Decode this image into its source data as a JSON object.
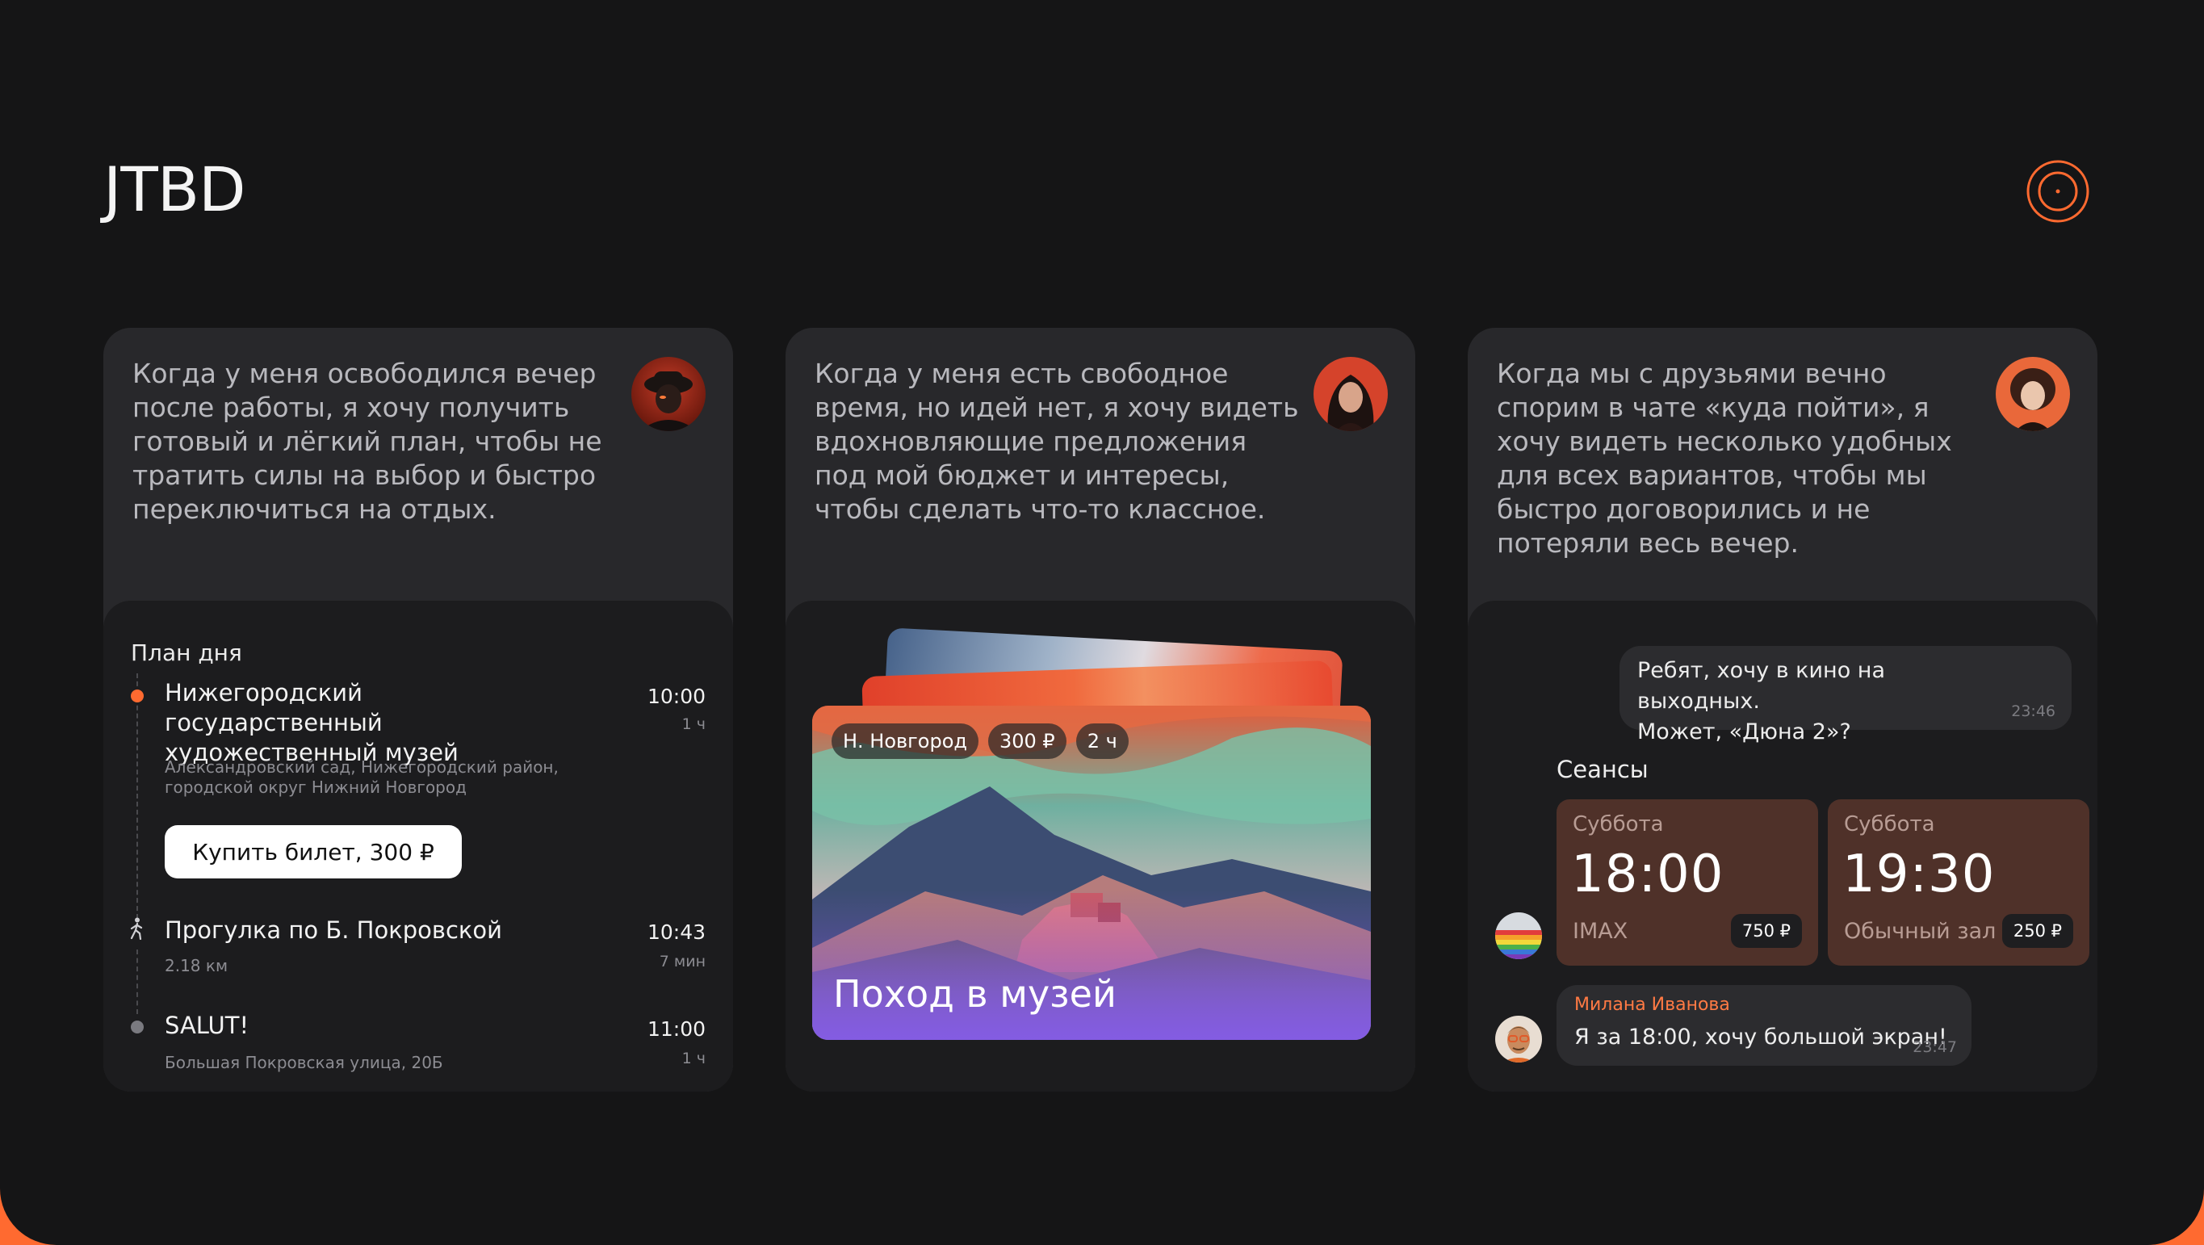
{
  "page": {
    "title": "JTBD",
    "accent_color": "#ff6a30",
    "target_icon": "target-icon"
  },
  "cards": [
    {
      "quote": "Когда у меня освободился вечер после работы, я хочу получить готовый и лёгкий план, чтобы не тратить силы на выбор и быстро переключиться на отдых.",
      "avatar": "person-in-hat-avatar",
      "plan": {
        "title": "План дня",
        "events": [
          {
            "title": "Нижегородский государственный художественный музей",
            "subtitle": "Александровский сад, Нижегородский район, городской округ Нижний Новгород",
            "time": "10:00",
            "duration": "1 ч",
            "button": "Купить билет, 300 ₽"
          },
          {
            "title": "Прогулка по Б. Покровской",
            "subtitle": "2.18 км",
            "time": "10:43",
            "duration": "7 мин"
          },
          {
            "title": "SALUT!",
            "subtitle": "Большая Покровская улица, 20Б",
            "time": "11:00",
            "duration": "1 ч"
          }
        ]
      }
    },
    {
      "quote": "Когда у меня есть свободное время, но идей нет, я хочу видеть вдохновляющие предложения под мой бюджет и интересы, чтобы сделать что-то классное.",
      "avatar": "woman-red-background-avatar",
      "offer": {
        "chips": [
          "Н. Новгород",
          "300 ₽",
          "2 ч"
        ],
        "title": "Поход в музей"
      }
    },
    {
      "quote": "Когда мы с друзьями вечно спорим в чате «куда пойти», я хочу видеть несколько удобных для всех вариантов, чтобы мы быстро договорились и не потеряли весь вечер.",
      "avatar": "woman-orange-background-avatar",
      "chat": {
        "message": {
          "line1": "Ребят, хочу в кино на выходных.",
          "line2": "Может, «Дюна 2»?",
          "time": "23:46"
        },
        "sessions_title": "Сеансы",
        "sessions": [
          {
            "day": "Суббота",
            "time": "18:00",
            "hall": "IMAX",
            "price": "750 ₽"
          },
          {
            "day": "Суббота",
            "time": "19:30",
            "hall": "Обычный зал",
            "price": "250 ₽"
          }
        ],
        "reply": {
          "name": "Милана Иванова",
          "text": "Я за 18:00, хочу большой экран!",
          "time": "23:47"
        }
      }
    }
  ]
}
